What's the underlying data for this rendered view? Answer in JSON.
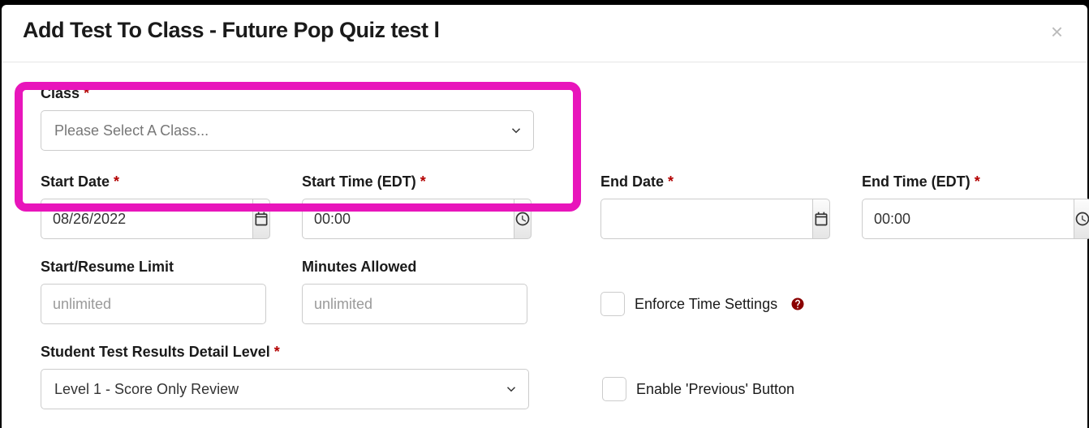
{
  "modal": {
    "title": "Add Test To Class - Future Pop Quiz test l",
    "close": "×"
  },
  "class": {
    "label": "Class",
    "placeholder": "Please Select A Class..."
  },
  "start_date": {
    "label": "Start Date",
    "value": "08/26/2022"
  },
  "start_time": {
    "label": "Start Time (EDT)",
    "value": "00:00"
  },
  "end_date": {
    "label": "End Date",
    "value": ""
  },
  "end_time": {
    "label": "End Time (EDT)",
    "value": "00:00"
  },
  "start_resume": {
    "label": "Start/Resume Limit",
    "placeholder": "unlimited"
  },
  "minutes_allowed": {
    "label": "Minutes Allowed",
    "placeholder": "unlimited"
  },
  "enforce_time": {
    "label": "Enforce Time Settings"
  },
  "detail_level": {
    "label": "Student Test Results Detail Level",
    "value": "Level 1 - Score Only Review"
  },
  "enable_prev": {
    "label": "Enable 'Previous' Button"
  }
}
